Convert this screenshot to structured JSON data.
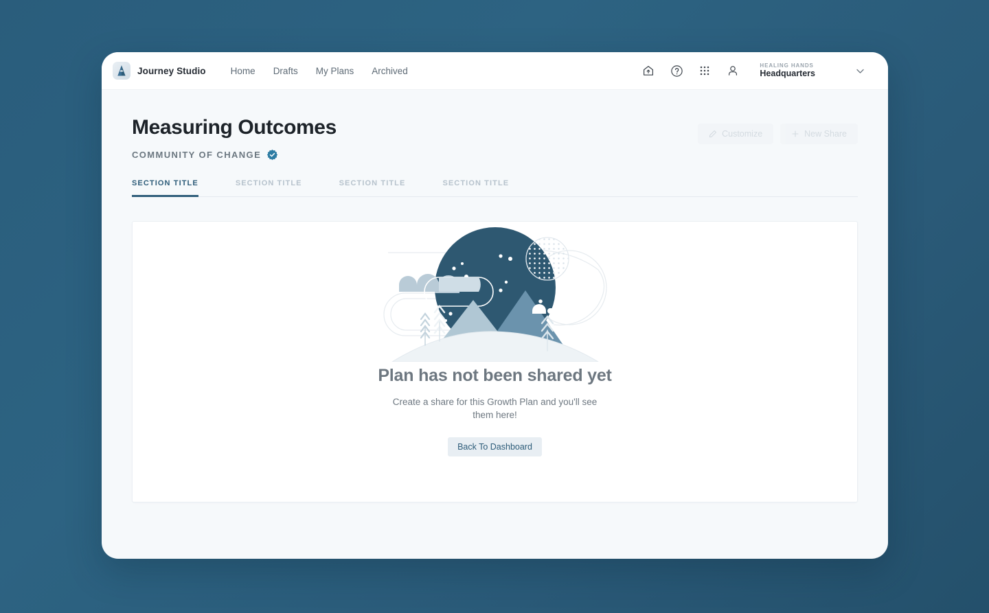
{
  "window": {
    "brand": {
      "logo_icon": "mountain-peak-logo",
      "name": "Journey Studio"
    },
    "nav_links": [
      {
        "label": "Home"
      },
      {
        "label": "Drafts"
      },
      {
        "label": "My Plans"
      },
      {
        "label": "Archived"
      }
    ],
    "nav_icons": [
      {
        "icon": "home-icon"
      },
      {
        "icon": "help-circle-icon"
      },
      {
        "icon": "app-grid-icon"
      },
      {
        "icon": "user-icon"
      }
    ],
    "org": {
      "parent": "HEALING HANDS",
      "name": "Headquarters",
      "chevron_icon": "chevron-down-icon"
    }
  },
  "page": {
    "title": "Measuring Outcomes",
    "subtitle": "COMMUNITY OF CHANGE",
    "verified_icon": "verified-badge-icon",
    "actions": [
      {
        "label": "Customize",
        "icon": "pencil-icon",
        "disabled": true
      },
      {
        "label": "New Share",
        "icon": "plus-icon",
        "disabled": true
      }
    ],
    "tabs": [
      {
        "label": "SECTION TITLE",
        "active": true
      },
      {
        "label": "SECTION TITLE",
        "active": false
      },
      {
        "label": "SECTION TITLE",
        "active": false
      },
      {
        "label": "SECTION TITLE",
        "active": false
      }
    ]
  },
  "empty_state": {
    "illustration": "mountain-night-scene-illustration",
    "title": "Plan has not been shared yet",
    "description": "Create a share for this Growth Plan and you'll see them here!",
    "button_label": "Back To Dashboard"
  },
  "colors": {
    "page_background": "#2a5d7c",
    "accent": "#2d5c79",
    "verified_badge": "#2d7ca3",
    "illustration_dark": "#2e5871",
    "illustration_mid": "#6b93ad",
    "illustration_light": "#b0c7d4"
  }
}
